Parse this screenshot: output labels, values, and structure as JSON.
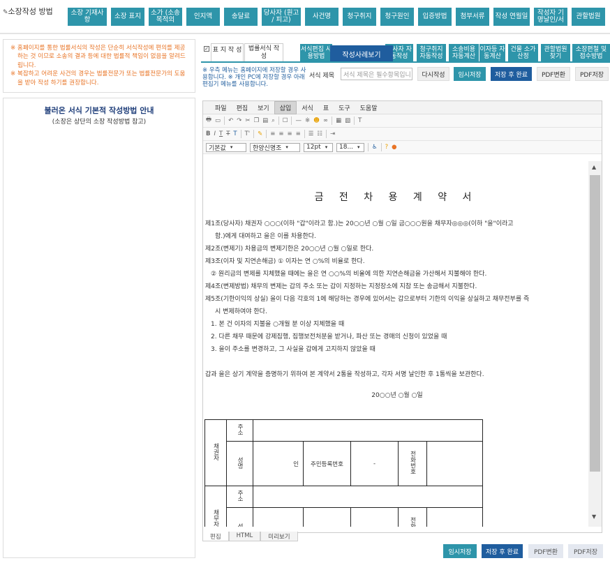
{
  "header": {
    "title": "소장작성 방법",
    "icon": "form-icon"
  },
  "nav": [
    "소장 기재사항",
    "소장 표지",
    "소가 (소송목적의",
    "인지액",
    "송달료",
    "당사자 (원고 / 피고)",
    "사건명",
    "청구취지",
    "청구원인",
    "입증방법",
    "첨부서류",
    "작성 연월일",
    "작성자 기명날인/서",
    "관할법원"
  ],
  "notice": [
    "※ 홈페이지를 통한 법률서식의 작성은 단순히 서식작성에 편의를 제공하는 것 이므로 소송의 결과 등에 대한 법률적 책임이 없음을 알려드립니다.",
    "※ 복잡하고 어려운 사건의 경우는 법률전문가 또는 법률전문가의 도움을 받아 작성 하기를 권장합니다."
  ],
  "guide": {
    "title": "불러온 서식 기본적 작성방법 안내",
    "subtitle": "(소장은 상단의 소장 작성방법 참고)"
  },
  "tabs": {
    "check": "✓",
    "cover": "표 지 작 성",
    "form": "법률서식 작 성",
    "usage": "서식편집 사용방법",
    "case_example": "작성사례보기",
    "party": "당사자 자동작성",
    "claim": "청구취지 자동작성",
    "cost": "소송비용 자동계산",
    "interest": "이자등 자동계산",
    "value": "건물 소가산정",
    "court": "관할법원 찾기",
    "fee": "소장편철 및 접수방법"
  },
  "save_note": "※ 우측 메뉴는 홈페이지에 저장할 경우 사용합니다. ※ 개인 PC에 저장할 경우 아래 편집기 메뉴를 사용합니다.",
  "form_name": {
    "label": "서식 제목",
    "placeholder": "서식 제목은 필수항목입니"
  },
  "actions": {
    "rewrite": "다시작성",
    "temp_save": "임시저장",
    "save_done": "저장 후 완료",
    "pdf": "PDF변환",
    "pdf_save": "PDF저장"
  },
  "editor": {
    "menu": [
      "파일",
      "편집",
      "보기",
      "삽입",
      "서식",
      "표",
      "도구",
      "도움말"
    ],
    "style": "기본값",
    "font": "한양신명조",
    "size": "12pt",
    "line": "18...",
    "doc_title": "금 전 차 용 계 약 서",
    "lines": [
      "제1조(당사자) 채권자 ○○○(이하 \"갑\"이라고 함.)는 20○○년 ○월 ○일 금○○○원을 채무자◎◎◎(이하 \"을\"이라고",
      "함.)에게 대여하고 을은 이를 차용한다.",
      "제2조(변제기) 차용금의 변제기한은 20○○년 ○월 ○일로 한다.",
      "제3조(이자 및 지연손해금) ① 이자는 연 ○%의 비율로 한다.",
      "② 원리금의 변제를 지체했을 때에는 을은 연  ○○%의 비율에 의한 지연손해금을 가산해서 지불해야 한다.",
      "제4조(변제방법) 채무의 변제는 갑의 주소 또는 갑이 지정하는 지정장소에 지참 또는 송금해서 지불한다.",
      "제5조(기한이익의 상실)  을이 다음 각호의 1에 해당하는 경우에 있어서는 갑으로부터 기한의 이익을 상실하고 채무전부를 즉",
      "시 변제하여야 한다.",
      "1. 본 건 이자의 지불을 ○개월 분 이상 지체했을 때",
      "2. 다른 채무 때문에 강제집행, 집행보전처분을 받거나, 파산 또는 경매의 신청이 있었을 때",
      "3. 을이 주소를 변경하고, 그 사실을 갑에게 고지하지 않았을 때"
    ],
    "closing": "갑과 을은 상기 계약을 증명하기 위하여 본 계약서 2통을 작성하고, 각자 서명  날인한 후 1통씩을 보관한다.",
    "date": "20○○년 ○월 ○일",
    "table": {
      "creditor": "채권자",
      "debtor": "채무자",
      "address": "주소",
      "name": "성명",
      "seal": "인",
      "rrn": "주민등록번호",
      "dash": "-",
      "phone": "전화번호"
    },
    "tabs": [
      "편집",
      "HTML",
      "미리보기"
    ]
  }
}
